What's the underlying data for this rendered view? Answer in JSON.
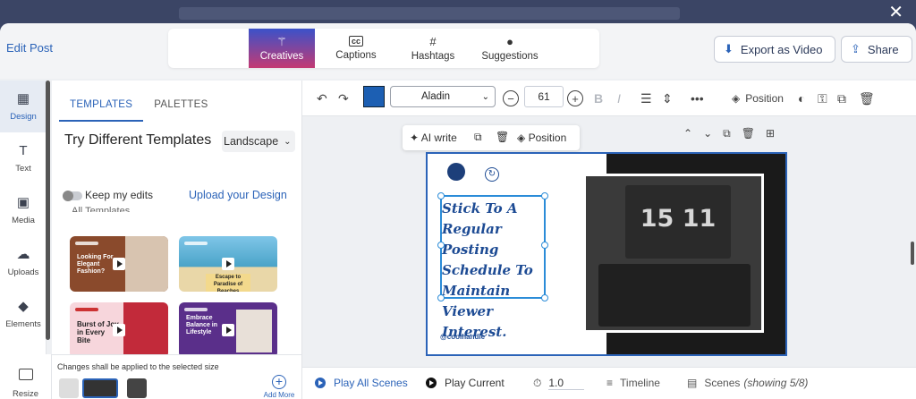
{
  "header": {
    "edit_post": "Edit Post",
    "tabs": [
      {
        "label": "Creatives",
        "icon": "magic-wand-icon"
      },
      {
        "label": "Captions",
        "icon": "cc-icon"
      },
      {
        "label": "Hashtags",
        "icon": "hash-icon"
      },
      {
        "label": "Suggestions",
        "icon": "lightbulb-icon"
      }
    ],
    "export_label": "Export as Video",
    "share_label": "Share"
  },
  "rail": {
    "items": [
      {
        "label": "Design",
        "icon": "grid-icon"
      },
      {
        "label": "Text",
        "icon": "text-icon"
      },
      {
        "label": "Media",
        "icon": "image-icon"
      },
      {
        "label": "Uploads",
        "icon": "cloud-upload-icon"
      },
      {
        "label": "Elements",
        "icon": "shapes-icon"
      }
    ],
    "resize_label": "Resize"
  },
  "panel": {
    "tabs": [
      "TEMPLATES",
      "PALETTES"
    ],
    "title": "Try Different Templates",
    "orientation": "Landscape",
    "keep_edits": "Keep my edits",
    "upload_design": "Upload your Design",
    "section_label": "All Templates",
    "templates": [
      {
        "text": "Looking For Elegant Fashion?"
      },
      {
        "text": "Escape to Paradise of Beaches"
      },
      {
        "text": "Burst of Joy in Every Bite"
      },
      {
        "text": "Embrace Balance in Lifestyle"
      }
    ],
    "resize_note": "Changes shall be applied to the selected size",
    "add_more": "Add More"
  },
  "toolbar": {
    "font": "Aladin",
    "font_size": "61",
    "position_label": "Position",
    "text_color": "#1c5fb3"
  },
  "canvas": {
    "ai_write": "AI write",
    "position_label": "Position",
    "slide_text_lines": [
      "Stick To A",
      "Regular Posting",
      "Schedule To",
      "Maintain Viewer",
      "Interest."
    ],
    "clock": "15 11",
    "handle": "@coolhandle"
  },
  "bottombar": {
    "play_all": "Play All Scenes",
    "play_current": "Play Current",
    "speed": "1.0",
    "timeline": "Timeline",
    "scenes": "Scenes",
    "scenes_count": "(showing 5/8)"
  }
}
